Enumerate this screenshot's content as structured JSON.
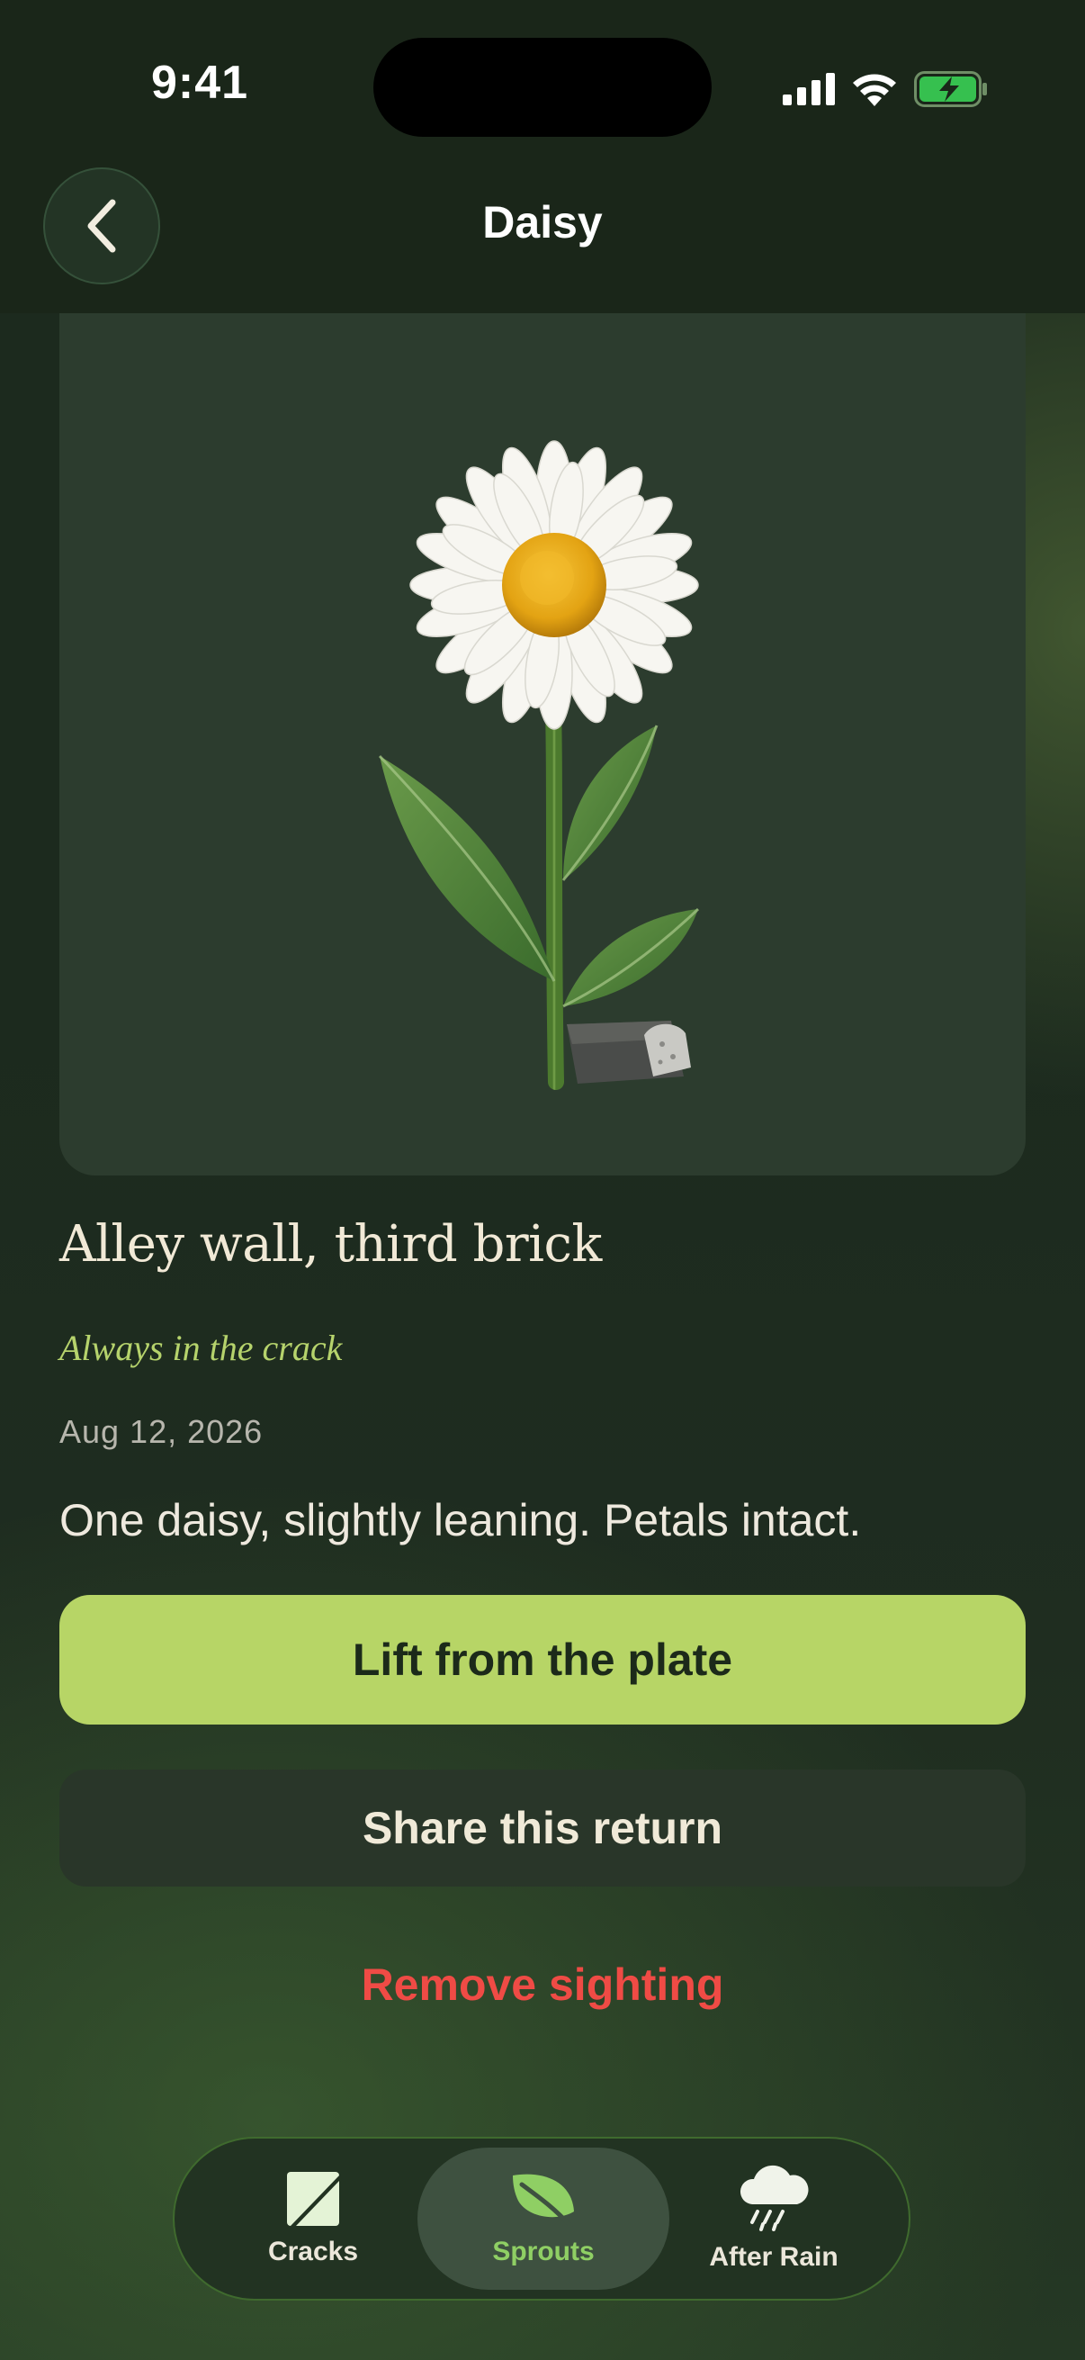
{
  "status_bar": {
    "time": "9:41"
  },
  "header": {
    "title": "Daisy"
  },
  "sighting": {
    "image_subject": "daisy-growing-from-crack",
    "location": "Alley wall, third brick",
    "tagline": "Always in the crack",
    "date": "Aug 12, 2026",
    "note": "One daisy, slightly leaning. Petals intact."
  },
  "actions": {
    "primary_label": "Lift from the plate",
    "secondary_label": "Share this return",
    "danger_label": "Remove sighting"
  },
  "tabbar": {
    "tabs": [
      {
        "label": "Cracks",
        "icon": "crack-icon",
        "active": false
      },
      {
        "label": "Sprouts",
        "icon": "leaf-icon",
        "active": true
      },
      {
        "label": "After Rain",
        "icon": "rain-cloud-icon",
        "active": false
      }
    ]
  },
  "colors": {
    "accent": "#b7d566",
    "danger": "#ef4b45",
    "active_tab": "#8fcf64",
    "background": "#1c2a1e"
  }
}
